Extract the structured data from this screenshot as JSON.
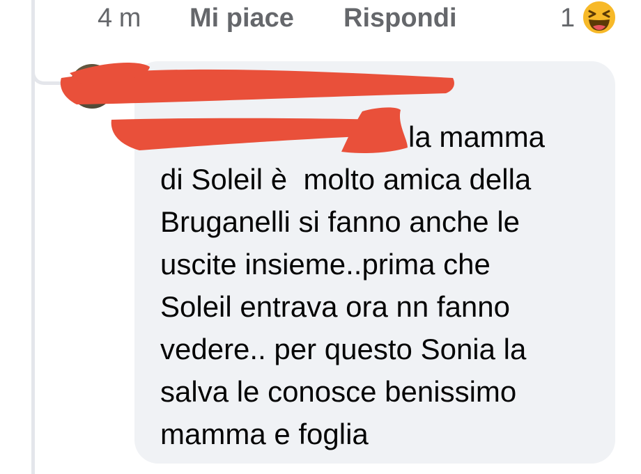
{
  "actions": {
    "time": "4 m",
    "like_label": "Mi piace",
    "reply_label": "Rispondi"
  },
  "reactions": {
    "count": "1",
    "icon": "laughing-emoji-icon"
  },
  "comment": {
    "author": "",
    "mention": "",
    "text": "la mamma\ndi Soleil è  molto amica della\nBruganelli si fanno anche le\nuscite insieme..prima che\nSoleil entrava ora nn fanno\nvedere.. per questo Sonia la\nsalva le conosce benissimo\nmamma e foglia"
  },
  "colors": {
    "bubble": "#f0f2f5",
    "action_text": "#65676b",
    "redaction": "#e9503a",
    "mention": "#1b74e4"
  }
}
